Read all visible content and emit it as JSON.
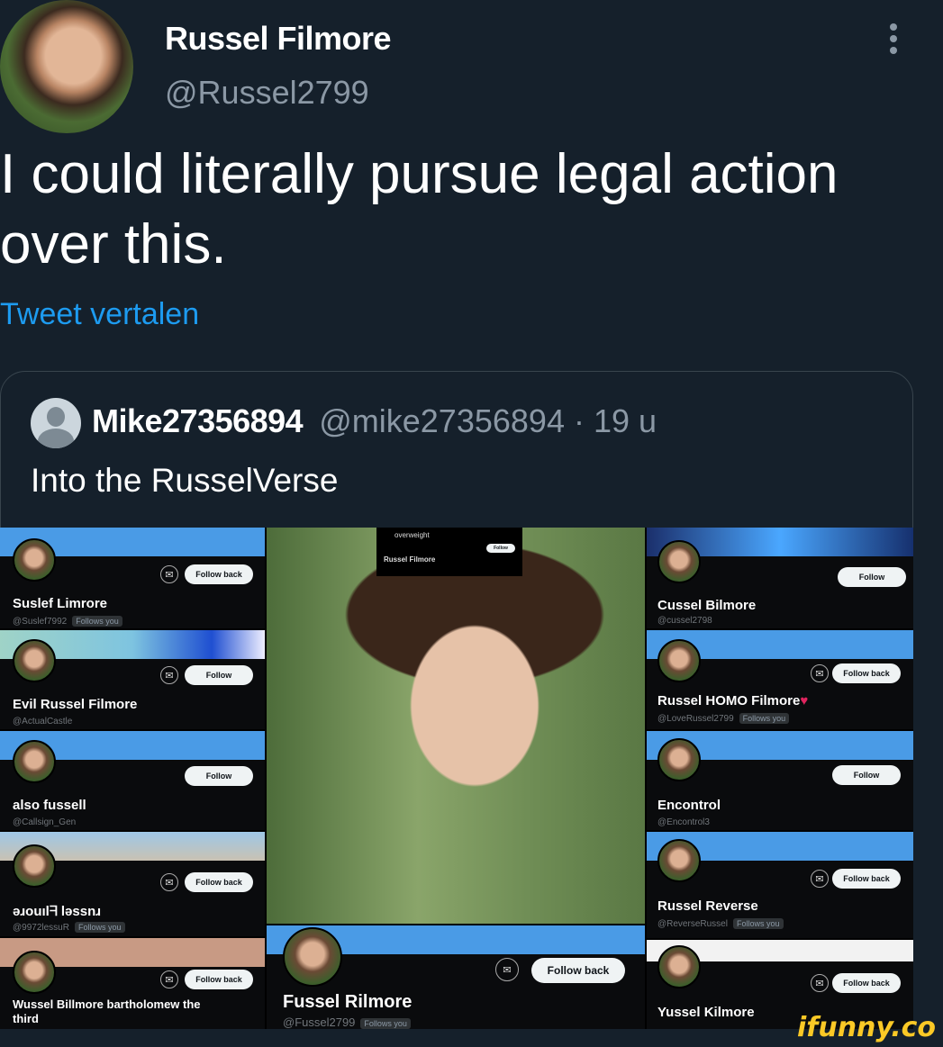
{
  "tweet": {
    "author_name": "Russel Filmore",
    "author_handle": "@Russel2799",
    "text": "I could literally pursue legal action over this.",
    "translate_label": "Tweet vertalen"
  },
  "quoted": {
    "name": "Mike27356894",
    "handle": "@mike27356894 · 19 u",
    "text": "Into the RusselVerse"
  },
  "collage": {
    "left": [
      {
        "name": "Suslef Limrore",
        "handle": "@Suslef7992",
        "button": "Follow back",
        "follows_you": "Follows you"
      },
      {
        "name": "Evil Russel Filmore",
        "handle": "@ActualCastle",
        "button": "Follow",
        "follows_you": ""
      },
      {
        "name": "also fussell",
        "handle": "@Callsign_Gen",
        "button": "Follow",
        "follows_you": ""
      },
      {
        "name": "ǝɹouılᖷ lǝssnɹ",
        "handle": "@9972lessuR",
        "button": "Follow back",
        "follows_you": "Follows you"
      },
      {
        "name": "Wussel Billmore bartholomew the third",
        "handle": "",
        "button": "Follow back",
        "follows_you": ""
      }
    ],
    "right": [
      {
        "name": "Cussel Bilmore",
        "handle": "@cussel2798",
        "button": "Follow",
        "follows_you": ""
      },
      {
        "name": "Russel HOMO Filmore",
        "handle": "@LoveRussel2799",
        "button": "Follow back",
        "follows_you": "Follows you"
      },
      {
        "name": "Encontrol",
        "handle": "@Encontrol3",
        "button": "Follow",
        "follows_you": ""
      },
      {
        "name": "Russel Reverse",
        "handle": "@ReverseRussel",
        "button": "Follow back",
        "follows_you": "Follows you"
      },
      {
        "name": "Yussel Kilmore",
        "handle": "",
        "button": "Follow back",
        "follows_you": ""
      }
    ],
    "bottom_center": {
      "name": "Fussel Rilmore",
      "handle": "@Fussel2799",
      "button": "Follow back",
      "follows_you": "Follows you"
    },
    "mini_card": {
      "text": "overweight",
      "name": "Russel Filmore",
      "button": "Follow"
    }
  },
  "watermark": "ifunny.co"
}
